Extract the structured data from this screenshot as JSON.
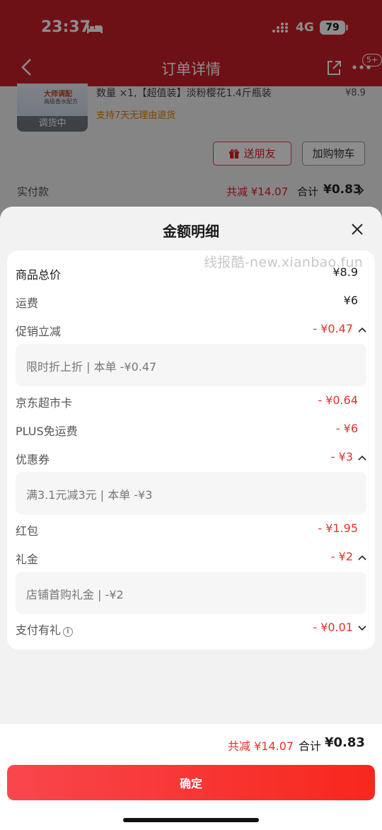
{
  "status_bar": {
    "time": "23:37",
    "network": "4G",
    "battery": "79"
  },
  "background": {
    "nav": {
      "title": "订单详情",
      "badge": "5+"
    },
    "product": {
      "thumb_tag": "调货中",
      "thumb_brand": "大师调配",
      "thumb_sub": "高级香水配方",
      "name": "数量 ×1,【超值装】淡粉樱花1.4斤瓶装",
      "price": "¥8.9",
      "return_policy": "支持7天无理由退货"
    },
    "buttons": {
      "gift": "送朋友",
      "add_cart": "加购物车"
    },
    "paid": {
      "label": "实付款",
      "discount": "共减 ¥14.07",
      "total_label": "合计",
      "total": "¥0.83"
    }
  },
  "sheet": {
    "title": "金额明细",
    "watermark": "线报酷-new.xianbao.fun",
    "rows": [
      {
        "label": "商品总价",
        "value": "¥8.9"
      },
      {
        "label": "运费",
        "value": "¥6"
      },
      {
        "label": "促销立减",
        "value": "- ¥0.47",
        "detail": "限时折上折 | 本单 -¥0.47"
      },
      {
        "label": "京东超市卡",
        "value": "- ¥0.64"
      },
      {
        "label": "PLUS免运费",
        "value": "- ¥6"
      },
      {
        "label": "优惠券",
        "value": "- ¥3",
        "detail": "满3.1元减3元 | 本单 -¥3"
      },
      {
        "label": "红包",
        "value": "- ¥1.95"
      },
      {
        "label": "礼金",
        "value": "- ¥2",
        "detail": "店铺首购礼金 | -¥2"
      },
      {
        "label": "支付有礼",
        "value": "- ¥0.01"
      }
    ],
    "footer": {
      "discount": "共减 ¥14.07",
      "total_label": "合计",
      "total": "¥0.83",
      "confirm": "确定"
    }
  },
  "colors": {
    "brand_red": "#c8202a",
    "price_red": "#e5322d",
    "button_red": "#f7271d"
  }
}
